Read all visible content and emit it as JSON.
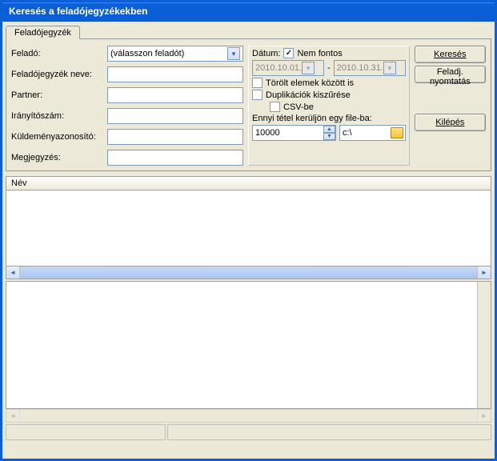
{
  "window": {
    "title": "Keresés a feladójegyzékekben"
  },
  "tab": {
    "label": "Feladójegyzék"
  },
  "labels": {
    "felado": "Feladó:",
    "fjn": "Feladójegyzék neve:",
    "partner": "Partner:",
    "irsz": "Irányítószám:",
    "kuld": "Küldeményazonosító:",
    "megj": "Megjegyzés:",
    "datum": "Dátum:",
    "nemfontos": "Nem fontos",
    "torolt": "Törölt elemek között is",
    "dup": "Duplikációk kiszűrése",
    "csv": "CSV-be",
    "ennyi": "Ennyi tétel kerüljön egy file-ba:",
    "datesep": "-"
  },
  "fields": {
    "felado_combo": "(válasszon feladót)",
    "fjn": "",
    "partner": "",
    "irsz": "",
    "kuld": "",
    "megj": "",
    "date_from": "2010.10.01.",
    "date_to": "2010.10.31.",
    "spin": "10000",
    "path": "c:\\"
  },
  "checks": {
    "nemfontos": true,
    "torolt": false,
    "dup": false,
    "csv": false
  },
  "buttons": {
    "kereses": "Keresés",
    "nyomt": "Feladj. nyomtatás",
    "kilep": "Kilépés"
  },
  "grid": {
    "col1": "Név"
  }
}
